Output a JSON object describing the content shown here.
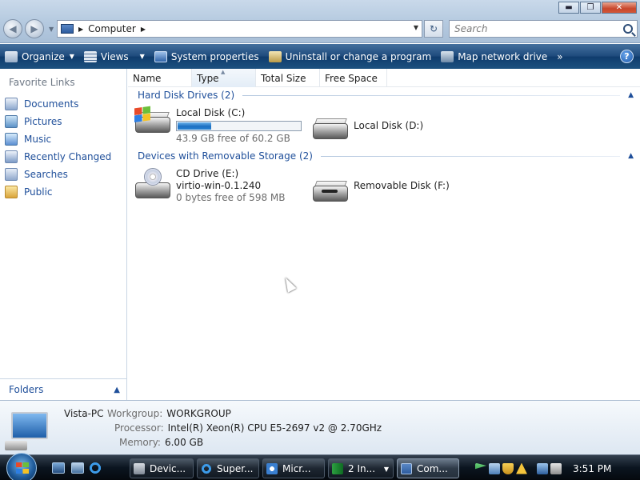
{
  "window": {
    "address_location": "Computer",
    "search_placeholder": "Search",
    "controls": {
      "minimize": "▬",
      "maximize": "❐",
      "close": "✕"
    }
  },
  "command_bar": {
    "organize": "Organize",
    "views": "Views",
    "system_properties": "System properties",
    "uninstall": "Uninstall or change a program",
    "map_drive": "Map network drive",
    "more": "»",
    "help": "?"
  },
  "nav_pane": {
    "title": "Favorite Links",
    "items": [
      {
        "label": "Documents",
        "icon": "documents-icon"
      },
      {
        "label": "Pictures",
        "icon": "pictures-icon"
      },
      {
        "label": "Music",
        "icon": "music-icon"
      },
      {
        "label": "Recently Changed",
        "icon": "recently-changed-icon"
      },
      {
        "label": "Searches",
        "icon": "searches-icon"
      },
      {
        "label": "Public",
        "icon": "public-folder-icon"
      }
    ],
    "folders": "Folders"
  },
  "columns": [
    "Name",
    "Type",
    "Total Size",
    "Free Space"
  ],
  "groups": {
    "hard_disks": "Hard Disk Drives (2)",
    "removable": "Devices with Removable Storage (2)"
  },
  "drives": {
    "c": {
      "name": "Local Disk (C:)",
      "free": "43.9 GB free of 60.2 GB",
      "used_fraction": 0.27
    },
    "d": {
      "name": "Local Disk (D:)"
    },
    "e": {
      "name": "CD Drive (E:)",
      "label": "virtio-win-0.1.240",
      "free": "0 bytes free of 598 MB"
    },
    "f": {
      "name": "Removable Disk (F:)"
    }
  },
  "details": {
    "computer_name": "Vista-PC",
    "workgroup_key": "Workgroup:",
    "workgroup_val": "WORKGROUP",
    "processor_key": "Processor:",
    "processor_val": "Intel(R) Xeon(R) CPU E5-2697 v2 @ 2.70GHz",
    "memory_key": "Memory:",
    "memory_val": "6.00 GB"
  },
  "taskbar": {
    "buttons": [
      "Devic...",
      "Super...",
      "Micr...",
      "2 In...",
      "Com..."
    ],
    "clock": "3:51 PM"
  },
  "colors": {
    "accent": "#1f4f9a",
    "command_bar": "#1d4a7c",
    "taskbar": "#0b1520"
  }
}
